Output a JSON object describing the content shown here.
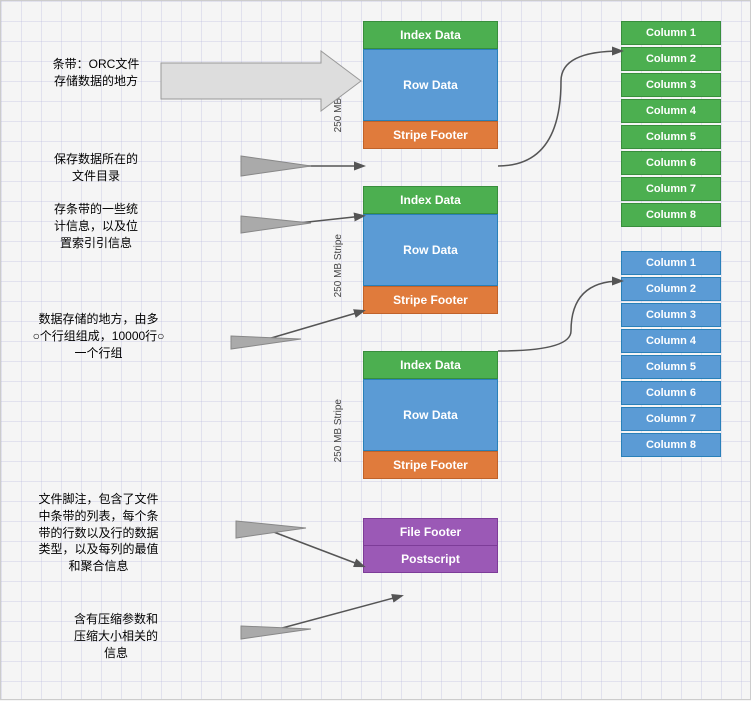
{
  "labels": {
    "stripe_title": "条带：ORC文件",
    "stripe_sub": "存储数据的地方",
    "file_dir_title": "保存数据所在的",
    "file_dir_sub": "文件目录",
    "stats_title": "存条带的一些统",
    "stats_line2": "计信息，以及位",
    "stats_line3": "置索引引信息",
    "data_storage_title": "数据存储的地方，由多",
    "data_storage_line2": "○个行组组成，10000行○",
    "data_storage_line3": "一个行组",
    "file_footer_title": "文件脚注，包含了文件",
    "file_footer_line2": "中条带的列表，每个条",
    "file_footer_line3": "带的行数以及行的数据",
    "file_footer_line4": "类型，以及每列的最值",
    "file_footer_line5": "和聚合信息",
    "postscript_title": "含有压缩参数和",
    "postscript_line2": "压缩大小相关的",
    "postscript_line3": "信息"
  },
  "stripe1": {
    "label": "250 MB Stripe",
    "index": "Index Data",
    "row": "Row Data",
    "footer": "Stripe Footer"
  },
  "stripe2": {
    "label": "250 MB Stripe",
    "index": "Index Data",
    "row": "Row Data",
    "footer": "Stripe Footer"
  },
  "stripe3": {
    "label": "250 MB Stripe",
    "index": "Index Data",
    "row": "Row Data",
    "footer": "Stripe Footer"
  },
  "file_section": {
    "file_footer": "File Footer",
    "postscript": "Postscript"
  },
  "columns_group1": [
    "Column 1",
    "Column 2",
    "Column 3",
    "Column 4",
    "Column 5",
    "Column 6",
    "Column 7",
    "Column 8"
  ],
  "columns_group2": [
    "Column 1",
    "Column 2",
    "Column 3",
    "Column 4",
    "Column 5",
    "Column 6",
    "Column 7",
    "Column 8"
  ]
}
